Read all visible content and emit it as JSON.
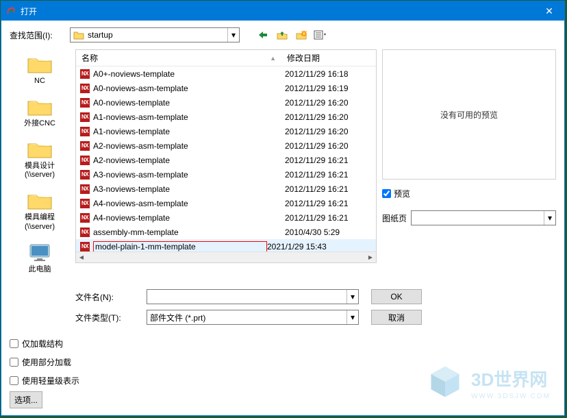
{
  "window": {
    "title": "打开"
  },
  "lookin": {
    "label": "查找范围(I):",
    "value": "startup"
  },
  "nav_icons": [
    "back-icon",
    "up-icon",
    "new-folder-icon",
    "view-menu-icon"
  ],
  "sidebar": {
    "items": [
      {
        "label": "NC",
        "icon": "folder"
      },
      {
        "label": "外接CNC",
        "icon": "folder"
      },
      {
        "label": "模具设计\n(\\\\server)",
        "icon": "folder"
      },
      {
        "label": "模具编程\n(\\\\server)",
        "icon": "folder"
      },
      {
        "label": "此电脑",
        "icon": "pc"
      }
    ]
  },
  "columns": {
    "name": "名称",
    "date": "修改日期"
  },
  "files": [
    {
      "name": "A0+-noviews-template",
      "date": "2012/11/29 16:18",
      "selected": false
    },
    {
      "name": "A0-noviews-asm-template",
      "date": "2012/11/29 16:19",
      "selected": false
    },
    {
      "name": "A0-noviews-template",
      "date": "2012/11/29 16:20",
      "selected": false
    },
    {
      "name": "A1-noviews-asm-template",
      "date": "2012/11/29 16:20",
      "selected": false
    },
    {
      "name": "A1-noviews-template",
      "date": "2012/11/29 16:20",
      "selected": false
    },
    {
      "name": "A2-noviews-asm-template",
      "date": "2012/11/29 16:20",
      "selected": false
    },
    {
      "name": "A2-noviews-template",
      "date": "2012/11/29 16:21",
      "selected": false
    },
    {
      "name": "A3-noviews-asm-template",
      "date": "2012/11/29 16:21",
      "selected": false
    },
    {
      "name": "A3-noviews-template",
      "date": "2012/11/29 16:21",
      "selected": false
    },
    {
      "name": "A4-noviews-asm-template",
      "date": "2012/11/29 16:21",
      "selected": false
    },
    {
      "name": "A4-noviews-template",
      "date": "2012/11/29 16:21",
      "selected": false
    },
    {
      "name": "assembly-mm-template",
      "date": "2010/4/30 5:29",
      "selected": false
    },
    {
      "name": "model-plain-1-mm-template",
      "date": "2021/1/29 15:43",
      "selected": true
    }
  ],
  "preview": {
    "empty_text": "没有可用的预览",
    "checkbox_label": "预览",
    "checkbox_checked": true,
    "page_label": "图纸页",
    "page_value": ""
  },
  "fields": {
    "filename_label": "文件名(N):",
    "filename_value": "",
    "filetype_label": "文件类型(T):",
    "filetype_value": "部件文件 (*.prt)",
    "ok_label": "OK",
    "cancel_label": "取消"
  },
  "checks": {
    "load_structure": "仅加载结构",
    "partial_load": "使用部分加载",
    "lightweight": "使用轻量级表示"
  },
  "options_button": "选项...",
  "watermark": {
    "line1": "3D世界网",
    "line2": "WWW.3DSJW.COM"
  }
}
